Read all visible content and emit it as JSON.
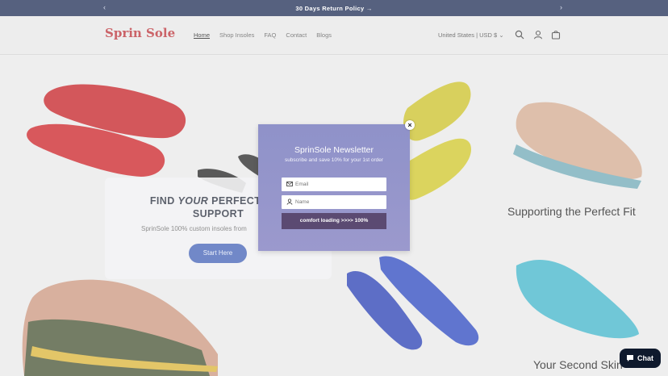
{
  "announcement": {
    "text": "30 Days Return Policy →",
    "prev": "‹",
    "next": "›"
  },
  "header": {
    "logo_text": "Sprin Sole",
    "nav": [
      "Home",
      "Shop Insoles",
      "FAQ",
      "Contact",
      "Blogs"
    ],
    "active_nav": "Home",
    "locale": "United States | USD $ ⌄",
    "icons": [
      "search-icon",
      "account-icon",
      "cart-icon"
    ]
  },
  "hero": {
    "title_line1_a": "FIND ",
    "title_line1_b": "YOUR",
    "title_line1_c": " PERFECT FITT",
    "title_line2": "SUPPORT",
    "subtitle": "SprinSole 100% custom insoles from",
    "cta": "Start Here",
    "caption_1": "Supporting the Perfect Fit",
    "caption_2": "Your Second Skin"
  },
  "popup": {
    "close": "×",
    "title": "SprinSole Newsletter",
    "subtitle": "subscribe and save 10% for your 1st order",
    "email_placeholder": "Email",
    "name_placeholder": "Name",
    "submit": "comfort loading >>>> 100%"
  },
  "chat": {
    "label": "Chat"
  },
  "colors": {
    "topbar": "#15244e",
    "brand": "#b8282e",
    "cta": "#3b5bb3",
    "popup": "#9496cb",
    "submit": "#5b4a72"
  }
}
